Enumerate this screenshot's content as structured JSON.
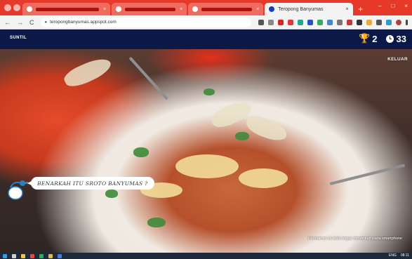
{
  "browser": {
    "tabs": [
      {
        "label": "",
        "active": false
      },
      {
        "label": "",
        "active": false
      },
      {
        "label": "",
        "active": false
      },
      {
        "label": "Teropong Banyumas",
        "active": true
      }
    ],
    "close_glyph": "×",
    "new_tab_glyph": "+",
    "window_controls": [
      "–",
      "□",
      "×"
    ],
    "nav": {
      "back": "←",
      "forward": "→",
      "reload": "C"
    },
    "url": "teropongbanyumas.appspot.com",
    "colors": {
      "tab_strip": "#e6392a",
      "header": "#0c1947"
    }
  },
  "app": {
    "brand": "SUNTIL",
    "score": "2",
    "timer": "33",
    "logout_label": "KELUAR",
    "question": "BENARKAH ITU SROTO BANYUMAS ?",
    "hint": "Permainan ini lebih bagus dimainkan pada smartphone",
    "icons": {
      "score": "trophy-icon",
      "timer": "clock-icon",
      "mascot": "mascot-icon"
    },
    "colors": {
      "trophy": "#f3c233"
    }
  },
  "taskbar": {
    "tray": [
      "ENG",
      "08:11"
    ]
  }
}
